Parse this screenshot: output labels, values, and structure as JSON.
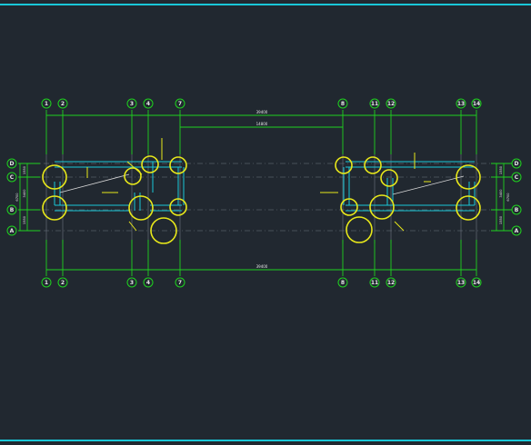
{
  "colors": {
    "background": "#212830",
    "frame": "#19c8d8",
    "axis": "#1fd21f",
    "column": "#e8e81a",
    "beam": "#19c8d8",
    "dim_text": "#e6e6e6",
    "faint": "#6e7680"
  },
  "top_axes": [
    "1",
    "2",
    "3",
    "4",
    "7",
    "8",
    "11",
    "12",
    "13",
    "14"
  ],
  "bottom_axes": [
    "1",
    "2",
    "3",
    "4",
    "7",
    "8",
    "11",
    "12",
    "13",
    "14"
  ],
  "left_rows": [
    "D",
    "C",
    "B",
    "A"
  ],
  "right_rows": [
    "D",
    "C",
    "B",
    "A"
  ],
  "dims": {
    "top_overall": "39400",
    "top_mid": "14800",
    "bottom_overall": "39400",
    "left_side": [
      "1550",
      "3400",
      "1550"
    ],
    "left_total": "6700",
    "right_side": [
      "1550",
      "3400",
      "1550"
    ],
    "right_total": "6700"
  }
}
